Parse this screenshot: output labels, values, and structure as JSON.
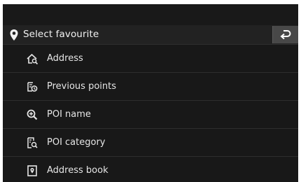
{
  "header": {
    "icon": "location-pin-icon",
    "title": "Select favourite",
    "back_icon": "back-arrow-icon"
  },
  "menu": {
    "items": [
      {
        "icon": "home-search-icon",
        "label": "Address"
      },
      {
        "icon": "history-search-icon",
        "label": "Previous points"
      },
      {
        "icon": "magnifier-plus-icon",
        "label": "POI name"
      },
      {
        "icon": "category-search-icon",
        "label": "POI category"
      },
      {
        "icon": "address-book-icon",
        "label": "Address book"
      }
    ]
  },
  "colors": {
    "background": "#181818",
    "header": "#222222",
    "back_button": "#484848",
    "text": "#e6e6e6"
  }
}
